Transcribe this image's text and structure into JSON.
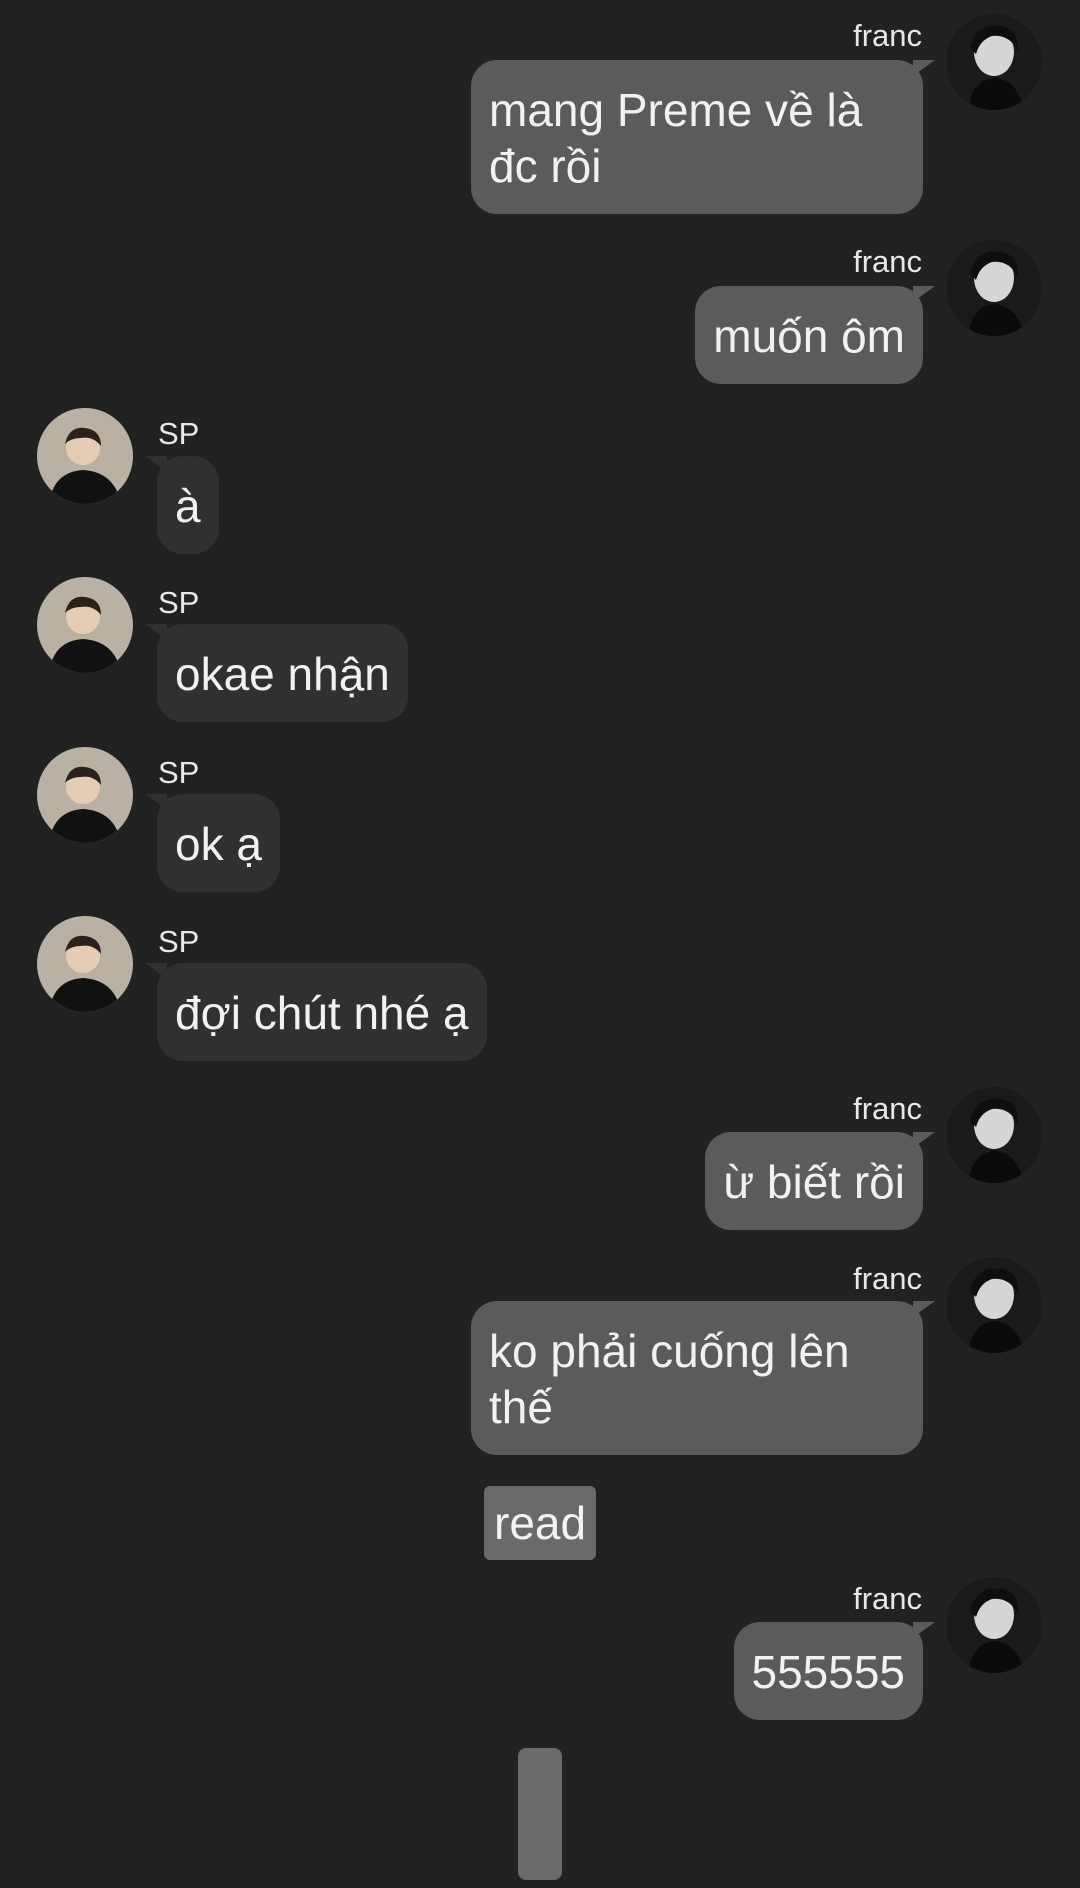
{
  "messages": [
    {
      "sender": "franc",
      "side": "right",
      "text_lines": [
        "mang Preme về là",
        "đc rồi"
      ]
    },
    {
      "sender": "franc",
      "side": "right",
      "text_lines": [
        "muốn ôm"
      ]
    },
    {
      "sender": "SP",
      "side": "left",
      "text_lines": [
        "à"
      ]
    },
    {
      "sender": "SP",
      "side": "left",
      "text_lines": [
        "okae nhận"
      ]
    },
    {
      "sender": "SP",
      "side": "left",
      "text_lines": [
        "ok ạ"
      ]
    },
    {
      "sender": "SP",
      "side": "left",
      "text_lines": [
        "đợi chút nhé ạ"
      ]
    },
    {
      "sender": "franc",
      "side": "right",
      "text_lines": [
        "ừ biết rồi"
      ]
    },
    {
      "sender": "franc",
      "side": "right",
      "text_lines": [
        "ko phải cuống lên",
        "thế"
      ]
    },
    {
      "sender": "franc",
      "side": "right",
      "text_lines": [
        "555555"
      ]
    }
  ],
  "read_badge": "read",
  "colors": {
    "background": "#212121",
    "outgoing_bubble": "#5b5b5b",
    "incoming_bubble": "#303030"
  },
  "icons": {
    "franc_avatar": "avatar-photo-franc",
    "sp_avatar": "avatar-photo-sp"
  }
}
